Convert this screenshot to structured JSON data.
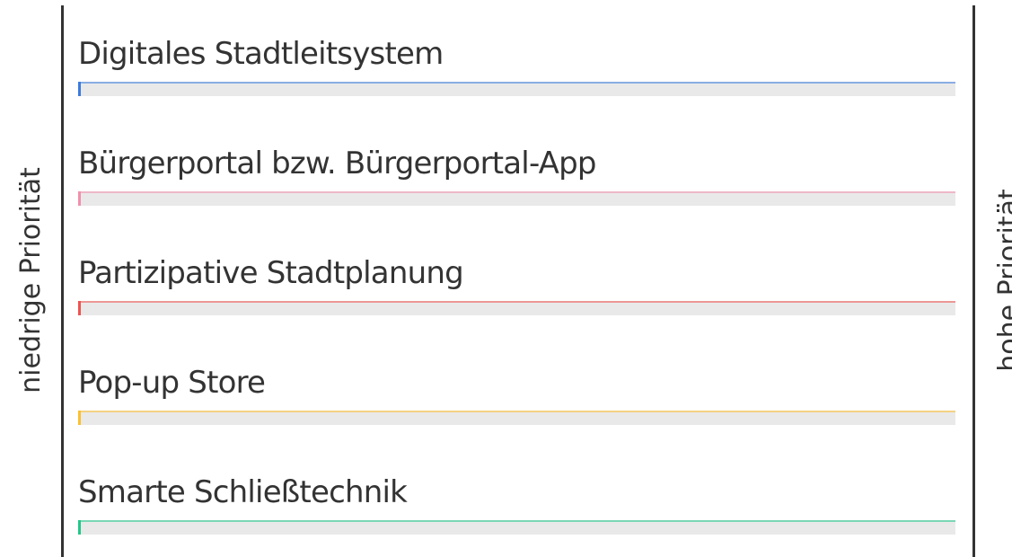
{
  "chart_data": {
    "type": "bar",
    "axis": {
      "low_label": "niedrige Priorität",
      "high_label": "hohe Priorität"
    },
    "categories": [
      "Digitales Stadtleitsystem",
      "Bürgerportal bzw. Bürgerportal-App",
      "Partizipative Stadtplanung",
      "Pop-up Store",
      "Smarte Schließtechnik"
    ],
    "values": [
      0.3,
      0.3,
      0.3,
      0.3,
      0.3
    ],
    "value_unit": "percent",
    "xlim": [
      0,
      100
    ],
    "colors": [
      "#3b7be0",
      "#f28fad",
      "#ef5350",
      "#fbc02d",
      "#1fc98a"
    ],
    "track_color": "#e9e9e9"
  }
}
